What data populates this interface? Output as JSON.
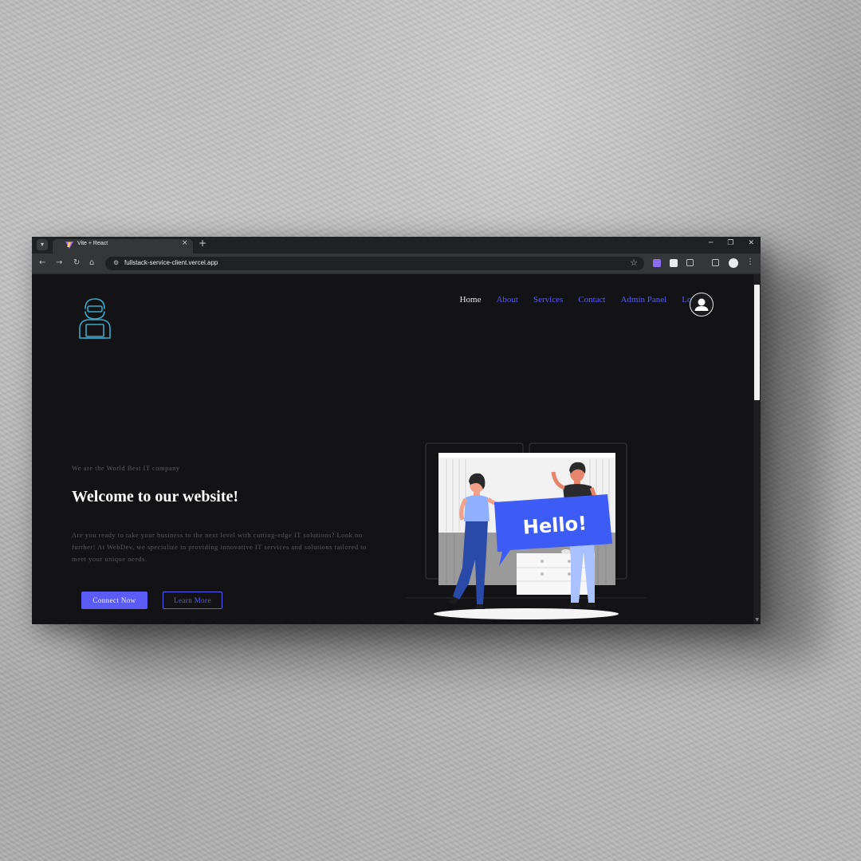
{
  "browser": {
    "tab_title": "Vite + React",
    "tab_close": "×",
    "new_tab": "+",
    "url": "fullstack-service-client.vercel.app",
    "back_icon": "←",
    "forward_icon": "→",
    "reload_icon": "↻",
    "home_icon": "⌂",
    "star_icon": "☆",
    "minimize_icon": "─",
    "restore_icon": "❐",
    "close_icon": "✕",
    "menu_icon": "⋮"
  },
  "nav": {
    "items": [
      {
        "label": "Home",
        "active": true
      },
      {
        "label": "About",
        "active": false
      },
      {
        "label": "Services",
        "active": false
      },
      {
        "label": "Contact",
        "active": false
      },
      {
        "label": "Admin Panel",
        "active": false
      },
      {
        "label": "Logout",
        "active": false
      }
    ]
  },
  "hero": {
    "tagline": "We are the World Best IT company",
    "title": "Welcome to our website!",
    "body": "Are you ready to take your business to the next level with cutting-edge IT solutions? Look no further! At WebDev, we specialize in providing innovative IT services and solutions tailored to meet your unique needs.",
    "primary_button": "Connect Now",
    "secondary_button": "Learn More",
    "sign_text": "Hello!"
  },
  "colors": {
    "accent": "#5b5bf5",
    "page_bg": "#131315",
    "logo_stroke": "#3aa7c7",
    "sign_blue": "#3d5cf5"
  }
}
